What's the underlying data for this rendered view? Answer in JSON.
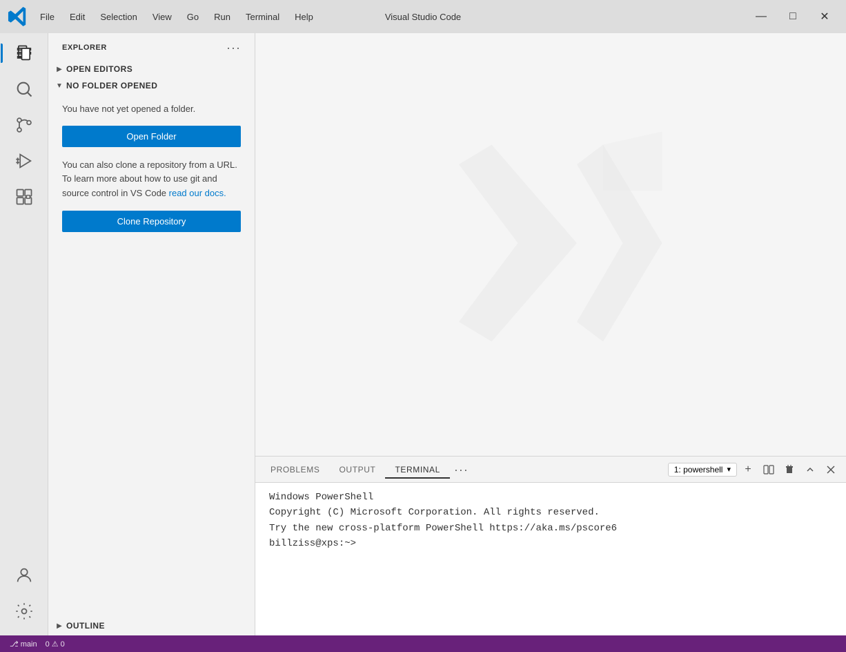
{
  "titleBar": {
    "title": "Visual Studio Code",
    "menuItems": [
      "File",
      "Edit",
      "Selection",
      "View",
      "Go",
      "Run",
      "Terminal",
      "Help"
    ],
    "controls": {
      "minimize": "—",
      "maximize": "□",
      "close": "✕"
    }
  },
  "activityBar": {
    "items": [
      {
        "name": "explorer",
        "tooltip": "Explorer"
      },
      {
        "name": "search",
        "tooltip": "Search"
      },
      {
        "name": "source-control",
        "tooltip": "Source Control"
      },
      {
        "name": "run-debug",
        "tooltip": "Run and Debug"
      },
      {
        "name": "extensions",
        "tooltip": "Extensions"
      }
    ],
    "bottomItems": [
      {
        "name": "account",
        "tooltip": "Account"
      },
      {
        "name": "settings",
        "tooltip": "Settings"
      }
    ]
  },
  "sidebar": {
    "header": "EXPLORER",
    "moreBtn": "···",
    "sections": {
      "openEditors": {
        "label": "OPEN EDITORS",
        "collapsed": true
      },
      "noFolder": {
        "label": "NO FOLDER OPENED",
        "collapsed": false,
        "infoText": "You have not yet opened a folder.",
        "openFolderBtn": "Open Folder",
        "cloneText": "You can also clone a repository from a URL. To learn more about how to use git and source control in VS Code ",
        "cloneLink": "read our docs.",
        "cloneRepoBtn": "Clone Repository"
      }
    },
    "outline": {
      "label": "OUTLINE"
    }
  },
  "terminal": {
    "tabs": [
      "PROBLEMS",
      "OUTPUT",
      "TERMINAL"
    ],
    "activeTab": "TERMINAL",
    "moreBtn": "···",
    "shellLabel": "1: powershell",
    "buttons": {
      "add": "+",
      "split": "⧉",
      "kill": "🗑",
      "up": "∧",
      "close": "✕"
    },
    "content": [
      "Windows PowerShell",
      "Copyright (C) Microsoft Corporation. All rights reserved.",
      "",
      "Try the new cross-platform PowerShell https://aka.ms/pscore6",
      "",
      "billziss@xps:~>"
    ]
  },
  "statusBar": {
    "items": [
      "⎇ main",
      "0 ⚠ 0"
    ]
  }
}
